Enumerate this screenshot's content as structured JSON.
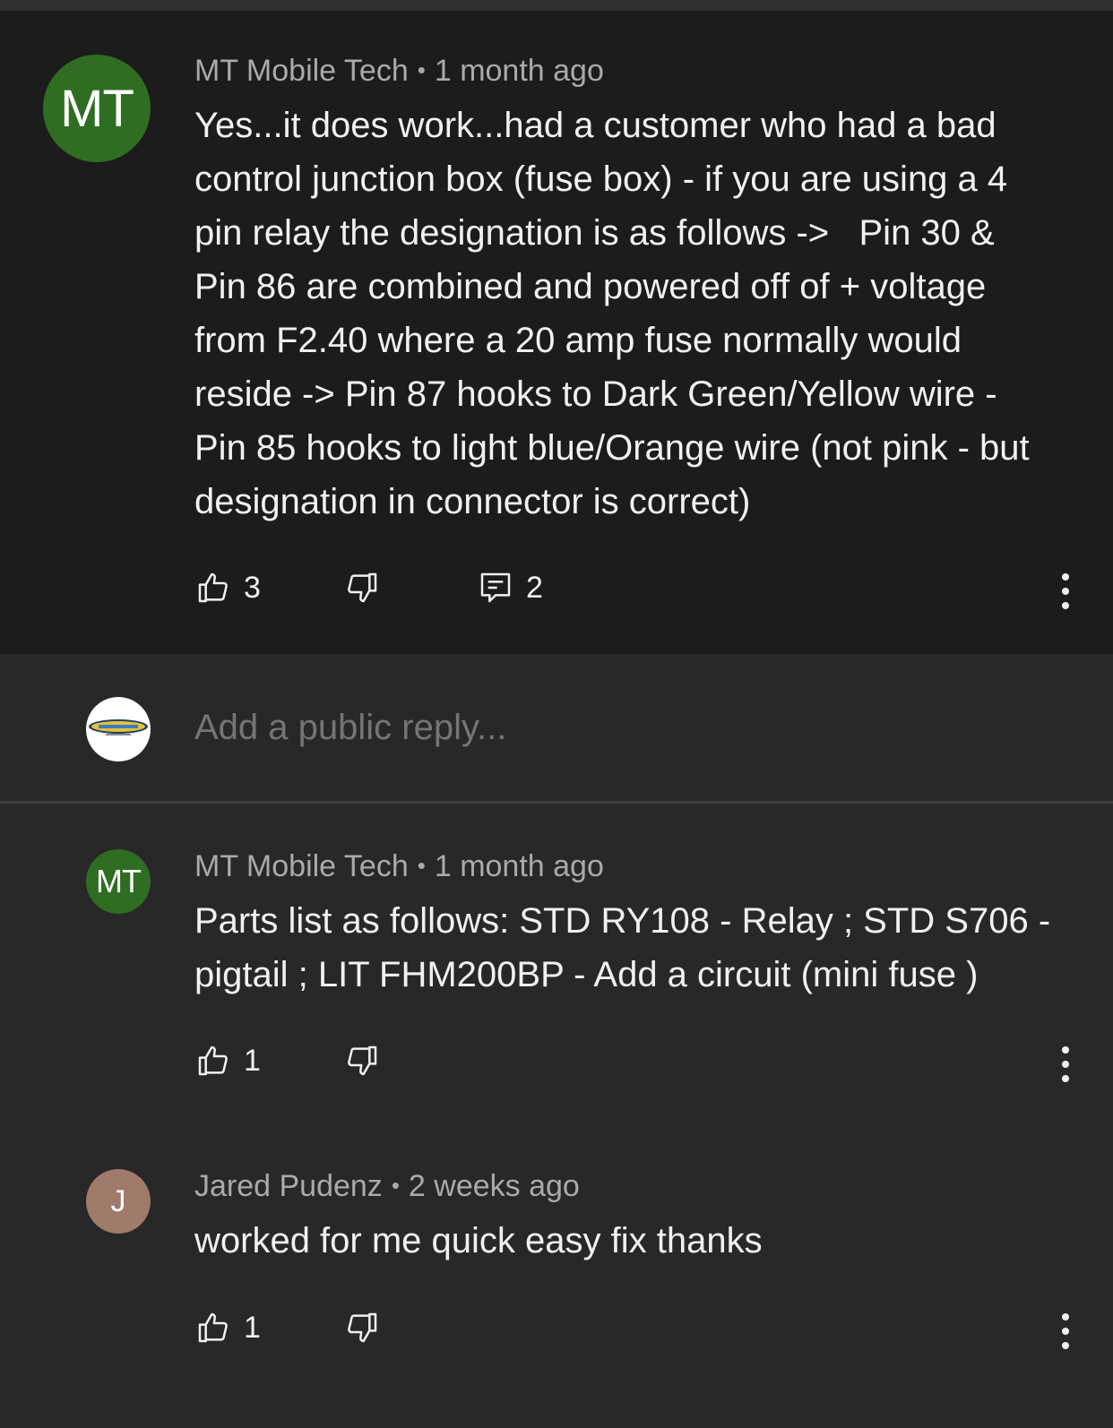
{
  "comments": [
    {
      "avatar_initials": "MT",
      "author": "MT Mobile Tech",
      "separator": "•",
      "time": "1 month ago",
      "lines": [
        "Yes...it does work...had a customer who had a bad",
        "control junction box (fuse box) - if you are using a 4",
        "pin relay the designation is as follows ->   Pin 30 &",
        "Pin 86 are combined and powered off of + voltage",
        "from F2.40 where a 20 amp fuse normally would",
        "reside -> Pin 87 hooks to Dark Green/Yellow wire -",
        "Pin 85 hooks to light blue/Orange wire (not pink - but",
        "designation in connector is correct)"
      ],
      "likes": "3",
      "replies": "2",
      "avatar_color": "#2f6e22"
    },
    {
      "avatar_initials": "MT",
      "author": "MT Mobile Tech",
      "separator": "•",
      "time": "1 month ago",
      "lines": [
        "Parts list as follows: STD RY108 - Relay ; STD S706 -",
        "pigtail ; LIT FHM200BP - Add a circuit (mini fuse )"
      ],
      "likes": "1",
      "avatar_color": "#2f6e22"
    },
    {
      "avatar_initials": "J",
      "author": "Jared Pudenz",
      "separator": "•",
      "time": "2 weeks ago",
      "lines": [
        "worked for me quick easy fix thanks"
      ],
      "likes": "1",
      "avatar_color": "#a07a6a"
    }
  ],
  "reply_box": {
    "placeholder": "Add a public reply..."
  },
  "icons": {
    "like": "thumbs-up-icon",
    "dislike": "thumbs-down-icon",
    "reply": "comment-icon",
    "more": "more-vertical-icon"
  },
  "colors": {
    "main_bg": "#1c1c1c",
    "thread_bg": "#282828",
    "text": "#f1f1f1",
    "muted": "#aaaaaa"
  }
}
